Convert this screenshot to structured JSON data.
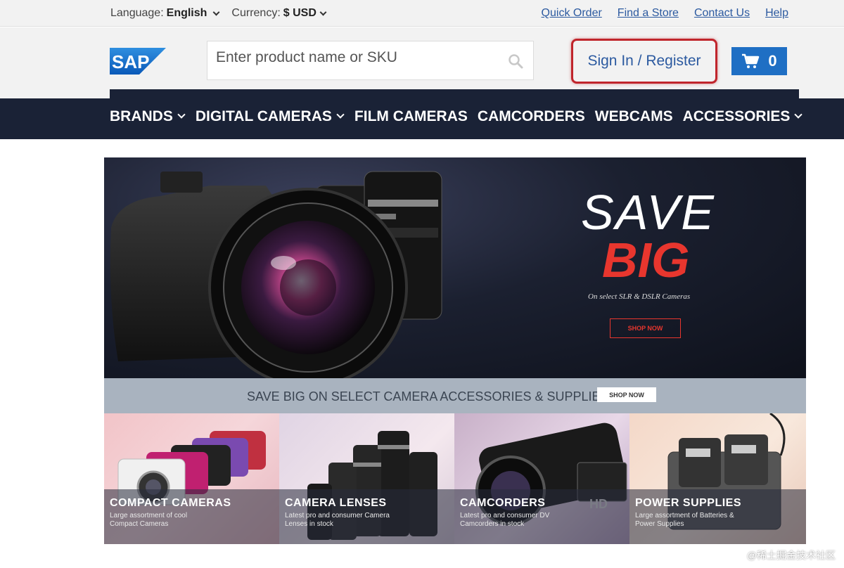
{
  "topbar": {
    "language_label": "Language:",
    "language_value": "English",
    "currency_label": "Currency:",
    "currency_value": "$ USD",
    "links": [
      "Quick Order",
      "Find a Store",
      "Contact Us",
      "Help"
    ]
  },
  "header": {
    "logo_text": "SAP",
    "search_placeholder": "Enter product name or SKU",
    "signin_label": "Sign In / Register",
    "cart_count": "0"
  },
  "nav": {
    "items": [
      {
        "label": "BRANDS",
        "dropdown": true
      },
      {
        "label": "DIGITAL CAMERAS",
        "dropdown": true
      },
      {
        "label": "FILM CAMERAS",
        "dropdown": false
      },
      {
        "label": "CAMCORDERS",
        "dropdown": false
      },
      {
        "label": "WEBCAMS",
        "dropdown": false
      },
      {
        "label": "ACCESSORIES",
        "dropdown": true
      }
    ]
  },
  "hero": {
    "line1": "SAVE",
    "line2": "BIG",
    "subtitle": "On select SLR & DSLR Cameras",
    "button": "SHOP NOW"
  },
  "band": {
    "text": "SAVE BIG ON SELECT CAMERA ACCESSORIES & SUPPLIES",
    "button": "SHOP NOW"
  },
  "tiles": [
    {
      "title": "COMPACT CAMERAS",
      "desc": "Large assortment of cool Compact Cameras"
    },
    {
      "title": "CAMERA LENSES",
      "desc": "Latest pro and consumer Camera Lenses in stock"
    },
    {
      "title": "CAMCORDERS",
      "desc": "Latest pro and consumer DV Camcorders in stock"
    },
    {
      "title": "POWER SUPPLIES",
      "desc": "Large assortment of Batteries & Power Supplies"
    }
  ],
  "watermark": "@稀土掘金技术社区",
  "colors": {
    "accent_blue": "#1f6fc4",
    "link_blue": "#2c5aa0",
    "nav_bg": "#1a2236",
    "highlight_red": "#c0252c",
    "promo_red": "#e8362e"
  }
}
